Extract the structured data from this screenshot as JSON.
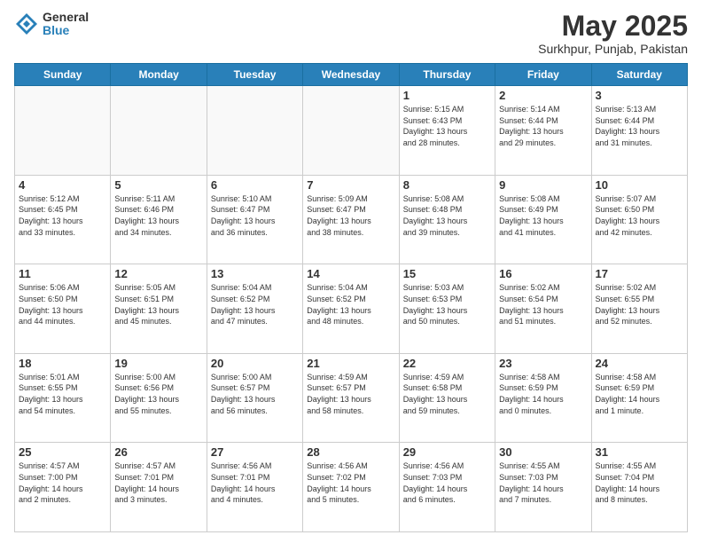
{
  "logo": {
    "general": "General",
    "blue": "Blue"
  },
  "header": {
    "month": "May 2025",
    "location": "Surkhpur, Punjab, Pakistan"
  },
  "days_of_week": [
    "Sunday",
    "Monday",
    "Tuesday",
    "Wednesday",
    "Thursday",
    "Friday",
    "Saturday"
  ],
  "weeks": [
    [
      {
        "day": "",
        "info": ""
      },
      {
        "day": "",
        "info": ""
      },
      {
        "day": "",
        "info": ""
      },
      {
        "day": "",
        "info": ""
      },
      {
        "day": "1",
        "info": "Sunrise: 5:15 AM\nSunset: 6:43 PM\nDaylight: 13 hours\nand 28 minutes."
      },
      {
        "day": "2",
        "info": "Sunrise: 5:14 AM\nSunset: 6:44 PM\nDaylight: 13 hours\nand 29 minutes."
      },
      {
        "day": "3",
        "info": "Sunrise: 5:13 AM\nSunset: 6:44 PM\nDaylight: 13 hours\nand 31 minutes."
      }
    ],
    [
      {
        "day": "4",
        "info": "Sunrise: 5:12 AM\nSunset: 6:45 PM\nDaylight: 13 hours\nand 33 minutes."
      },
      {
        "day": "5",
        "info": "Sunrise: 5:11 AM\nSunset: 6:46 PM\nDaylight: 13 hours\nand 34 minutes."
      },
      {
        "day": "6",
        "info": "Sunrise: 5:10 AM\nSunset: 6:47 PM\nDaylight: 13 hours\nand 36 minutes."
      },
      {
        "day": "7",
        "info": "Sunrise: 5:09 AM\nSunset: 6:47 PM\nDaylight: 13 hours\nand 38 minutes."
      },
      {
        "day": "8",
        "info": "Sunrise: 5:08 AM\nSunset: 6:48 PM\nDaylight: 13 hours\nand 39 minutes."
      },
      {
        "day": "9",
        "info": "Sunrise: 5:08 AM\nSunset: 6:49 PM\nDaylight: 13 hours\nand 41 minutes."
      },
      {
        "day": "10",
        "info": "Sunrise: 5:07 AM\nSunset: 6:50 PM\nDaylight: 13 hours\nand 42 minutes."
      }
    ],
    [
      {
        "day": "11",
        "info": "Sunrise: 5:06 AM\nSunset: 6:50 PM\nDaylight: 13 hours\nand 44 minutes."
      },
      {
        "day": "12",
        "info": "Sunrise: 5:05 AM\nSunset: 6:51 PM\nDaylight: 13 hours\nand 45 minutes."
      },
      {
        "day": "13",
        "info": "Sunrise: 5:04 AM\nSunset: 6:52 PM\nDaylight: 13 hours\nand 47 minutes."
      },
      {
        "day": "14",
        "info": "Sunrise: 5:04 AM\nSunset: 6:52 PM\nDaylight: 13 hours\nand 48 minutes."
      },
      {
        "day": "15",
        "info": "Sunrise: 5:03 AM\nSunset: 6:53 PM\nDaylight: 13 hours\nand 50 minutes."
      },
      {
        "day": "16",
        "info": "Sunrise: 5:02 AM\nSunset: 6:54 PM\nDaylight: 13 hours\nand 51 minutes."
      },
      {
        "day": "17",
        "info": "Sunrise: 5:02 AM\nSunset: 6:55 PM\nDaylight: 13 hours\nand 52 minutes."
      }
    ],
    [
      {
        "day": "18",
        "info": "Sunrise: 5:01 AM\nSunset: 6:55 PM\nDaylight: 13 hours\nand 54 minutes."
      },
      {
        "day": "19",
        "info": "Sunrise: 5:00 AM\nSunset: 6:56 PM\nDaylight: 13 hours\nand 55 minutes."
      },
      {
        "day": "20",
        "info": "Sunrise: 5:00 AM\nSunset: 6:57 PM\nDaylight: 13 hours\nand 56 minutes."
      },
      {
        "day": "21",
        "info": "Sunrise: 4:59 AM\nSunset: 6:57 PM\nDaylight: 13 hours\nand 58 minutes."
      },
      {
        "day": "22",
        "info": "Sunrise: 4:59 AM\nSunset: 6:58 PM\nDaylight: 13 hours\nand 59 minutes."
      },
      {
        "day": "23",
        "info": "Sunrise: 4:58 AM\nSunset: 6:59 PM\nDaylight: 14 hours\nand 0 minutes."
      },
      {
        "day": "24",
        "info": "Sunrise: 4:58 AM\nSunset: 6:59 PM\nDaylight: 14 hours\nand 1 minute."
      }
    ],
    [
      {
        "day": "25",
        "info": "Sunrise: 4:57 AM\nSunset: 7:00 PM\nDaylight: 14 hours\nand 2 minutes."
      },
      {
        "day": "26",
        "info": "Sunrise: 4:57 AM\nSunset: 7:01 PM\nDaylight: 14 hours\nand 3 minutes."
      },
      {
        "day": "27",
        "info": "Sunrise: 4:56 AM\nSunset: 7:01 PM\nDaylight: 14 hours\nand 4 minutes."
      },
      {
        "day": "28",
        "info": "Sunrise: 4:56 AM\nSunset: 7:02 PM\nDaylight: 14 hours\nand 5 minutes."
      },
      {
        "day": "29",
        "info": "Sunrise: 4:56 AM\nSunset: 7:03 PM\nDaylight: 14 hours\nand 6 minutes."
      },
      {
        "day": "30",
        "info": "Sunrise: 4:55 AM\nSunset: 7:03 PM\nDaylight: 14 hours\nand 7 minutes."
      },
      {
        "day": "31",
        "info": "Sunrise: 4:55 AM\nSunset: 7:04 PM\nDaylight: 14 hours\nand 8 minutes."
      }
    ]
  ]
}
